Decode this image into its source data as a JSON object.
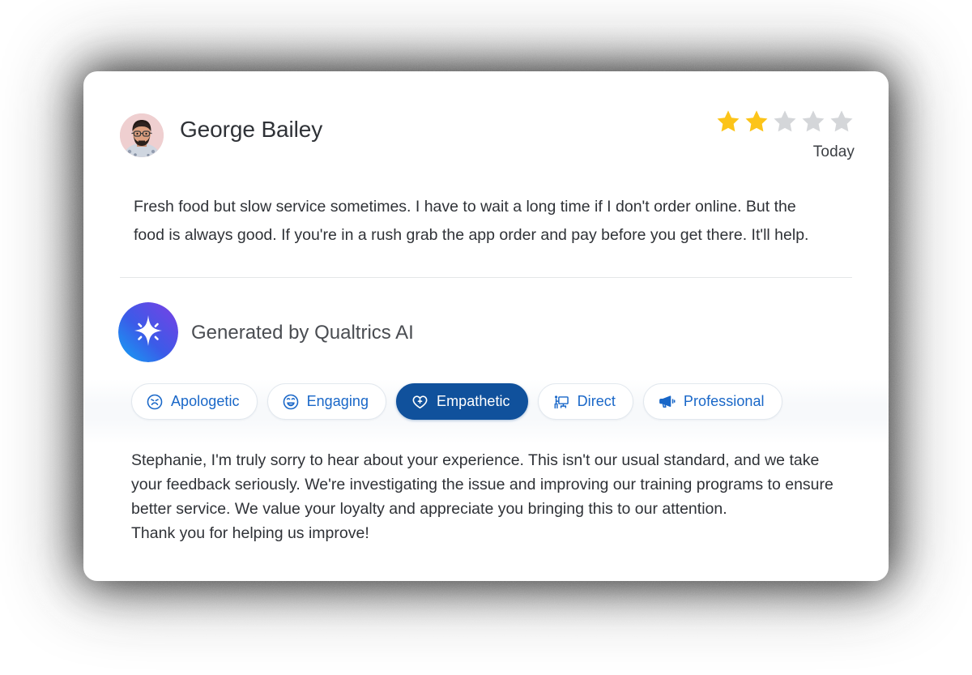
{
  "card": {
    "review": {
      "reviewer_name": "George Bailey",
      "avatar_icon": "user-avatar-photo",
      "rating": 2,
      "rating_max": 5,
      "star_filled_color": "#FCC419",
      "star_empty_color": "#D4D6D9",
      "timestamp": "Today",
      "body": "Fresh food but slow service sometimes. I have to wait a long time if I don't order online. But the food is always good. If you're in a rush grab the app order and pay before you get there. It'll help."
    },
    "ai_section": {
      "badge_icon": "ai-sparkle-icon",
      "badge_gradient_from": "#12A5F5",
      "badge_gradient_to": "#7B3FE4",
      "title": "Generated by Qualtrics AI",
      "tones": [
        {
          "label": "Apologetic",
          "icon": "sad-face-icon",
          "selected": false
        },
        {
          "label": "Engaging",
          "icon": "laughing-face-icon",
          "selected": false
        },
        {
          "label": "Empathetic",
          "icon": "heart-plus-icon",
          "selected": true
        },
        {
          "label": "Direct",
          "icon": "presentation-icon",
          "selected": false
        },
        {
          "label": "Professional",
          "icon": "megaphone-icon",
          "selected": false
        }
      ],
      "accent_color": "#1967C8",
      "selected_chip_color": "#10519C",
      "response_paragraph": "Stephanie, I'm truly sorry to hear about your experience. This isn't our usual standard, and we take your feedback seriously. We're investigating the issue and improving our training programs to ensure better service. We value your loyalty and appreciate you bringing this to our attention.",
      "response_closing": "Thank you for helping us improve!"
    }
  }
}
